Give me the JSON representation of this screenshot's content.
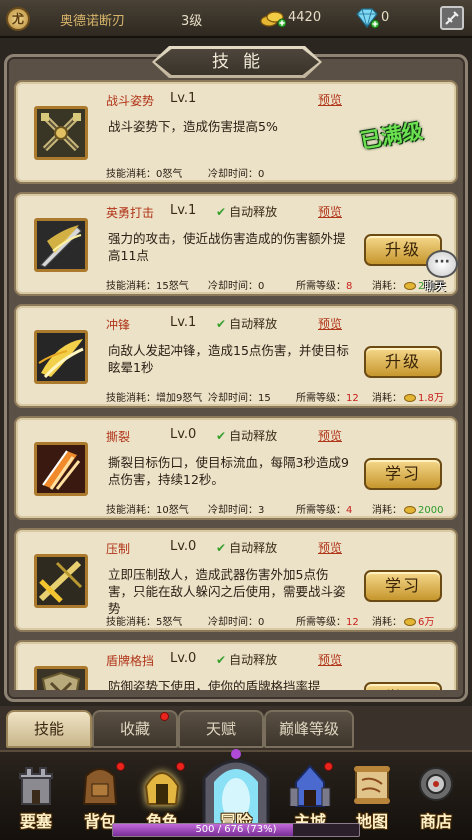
{
  "topbar": {
    "emblem": "尤",
    "player_name": "奥德诺断刃",
    "level": "3级",
    "gold": "4420",
    "gems": "0"
  },
  "panel_title": "技能",
  "labels": {
    "cost_prefix": "技能消耗：",
    "cooldown_prefix": "冷却时间：",
    "req_prefix": "所需等级：",
    "spend_prefix": "消耗：",
    "auto_cast": "自动释放",
    "preview": "预览",
    "maxed": "已满级"
  },
  "skills": [
    {
      "name": "战斗姿势",
      "level": "Lv.1",
      "auto": false,
      "desc": "战斗姿势下，造成伤害提高5%",
      "cost": "0怒气",
      "cooldown": "0",
      "req_level": "",
      "spend": "",
      "action": "",
      "maxed": true,
      "icon": "crossed-swords-icon"
    },
    {
      "name": "英勇打击",
      "level": "Lv.1",
      "auto": true,
      "desc": "强力的攻击，使近战伤害造成的伤害额外提高11点",
      "cost": "15怒气",
      "cooldown": "0",
      "req_level": "8",
      "spend": "2…",
      "action": "升级",
      "maxed": false,
      "icon": "heroic-strike-icon"
    },
    {
      "name": "冲锋",
      "level": "Lv.1",
      "auto": true,
      "desc": "向敌人发起冲锋，造成15点伤害，并使目标眩晕1秒",
      "cost": "增加9怒气",
      "cooldown": "15",
      "req_level": "12",
      "spend": "1.8万",
      "action": "升级",
      "maxed": false,
      "icon": "charge-icon"
    },
    {
      "name": "撕裂",
      "level": "Lv.0",
      "auto": true,
      "desc": "撕裂目标伤口，使目标流血，每隔3秒造成9点伤害，持续12秒。",
      "cost": "10怒气",
      "cooldown": "3",
      "req_level": "4",
      "spend": "2000",
      "action": "学习",
      "maxed": false,
      "icon": "rend-icon"
    },
    {
      "name": "压制",
      "level": "Lv.0",
      "auto": true,
      "desc": "立即压制敌人，造成武器伤害外加5点伤害，只能在敌人躲闪之后使用，需要战斗姿势",
      "cost": "5怒气",
      "cooldown": "0",
      "req_level": "12",
      "spend": "6万",
      "action": "学习",
      "maxed": false,
      "icon": "overpower-icon"
    },
    {
      "name": "盾牌格挡",
      "level": "Lv.0",
      "auto": true,
      "desc": "防御姿势下使用，使你的盾牌格挡率提",
      "cost": "",
      "cooldown": "",
      "req_level": "",
      "spend": "",
      "action": "学习",
      "maxed": false,
      "icon": "shield-block-icon"
    }
  ],
  "chat": {
    "label": "聊天"
  },
  "subtabs": [
    "技能",
    "收藏",
    "天赋",
    "巅峰等级"
  ],
  "nav": [
    "要塞",
    "背包",
    "角色",
    "冒险",
    "主城",
    "地图",
    "商店"
  ],
  "xp": {
    "text": "500 / 676 (73%)",
    "fraction": 0.73
  },
  "colors": {
    "skill_name": "#b03418",
    "auto_check": "#38a02e",
    "maxed_badge": "#6be050",
    "action_button": "#e6b94e",
    "xp_fill": "#b05ccc"
  }
}
